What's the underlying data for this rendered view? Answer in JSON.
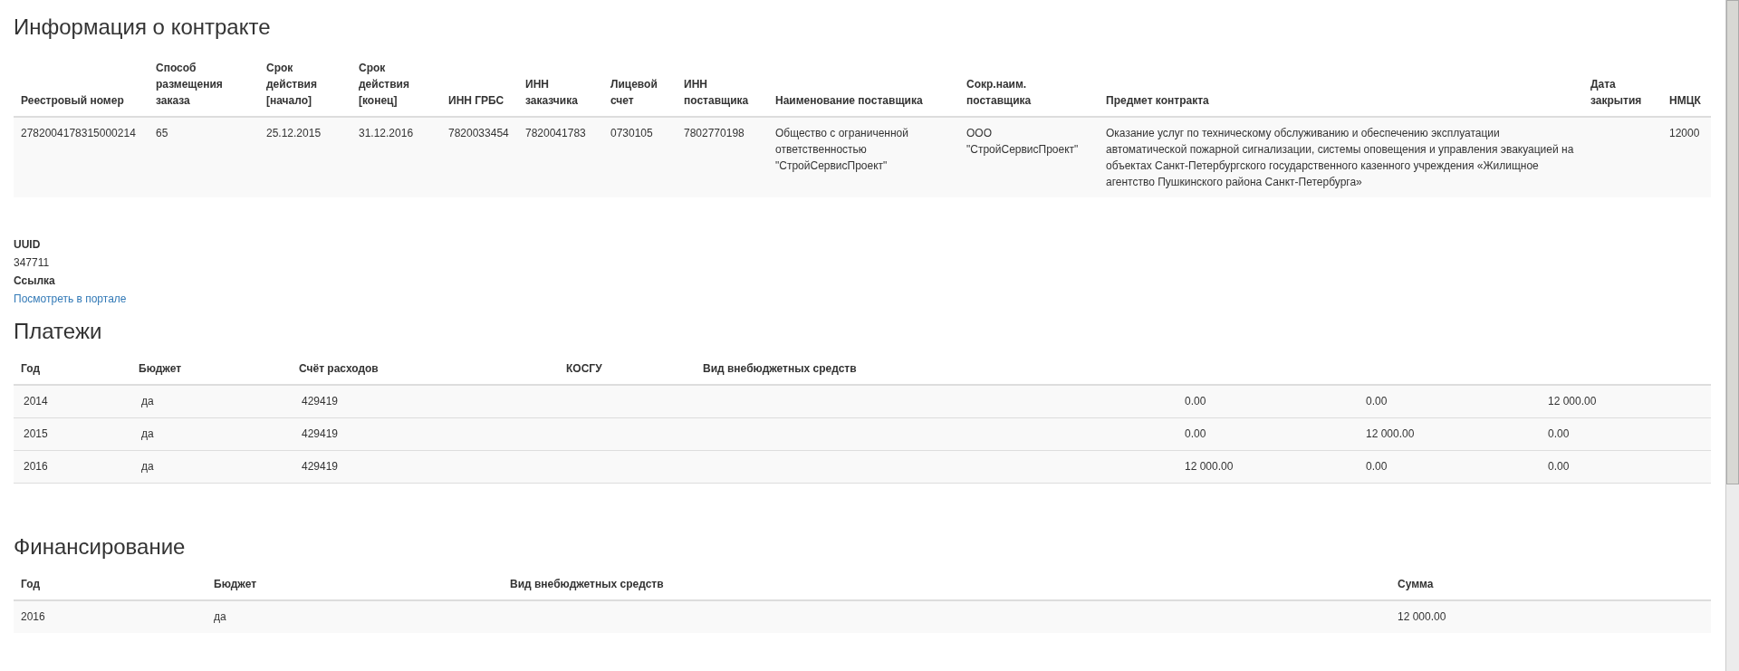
{
  "contract": {
    "title": "Информация о контракте",
    "columns": [
      "Реестровый номер",
      "Способ\nразмещения\nзаказа",
      "Срок\nдействия\n[начало]",
      "Срок\nдействия\n[конец]",
      "ИНН ГРБС",
      "ИНН\nзаказчика",
      "Лицевой\nсчет",
      "ИНН\nпоставщика",
      "Наименование поставщика",
      "Сокр.наим.\nпоставщика",
      "Предмет контракта",
      "Дата\nзакрытия",
      "НМЦК"
    ],
    "rows": [
      {
        "cells": [
          "2782004178315000214",
          "65",
          "25.12.2015",
          "31.12.2016",
          "7820033454",
          "7820041783",
          "0730105",
          "7802770198",
          "Общество с ограниченной ответственностью \"СтройСервисПроект\"",
          "ООО \"СтройСервисПроект\"",
          "Оказание услуг по техническому обслуживанию и обеспечению эксплуатации автоматической пожарной сигнализации, системы оповещения и управления эвакуацией на объектах Санкт-Петербургского государственного казенного учреждения «Жилищное агентство Пушкинского района Санкт-Петербурга»",
          null,
          "12000"
        ]
      }
    ]
  },
  "details": [
    {
      "label": "UUID",
      "value": "347711",
      "kind": "text"
    },
    {
      "label": "Ссылка",
      "value": "Посмотреть в портале",
      "kind": "link"
    }
  ],
  "payments": {
    "title": "Платежи",
    "columns": [
      "Год",
      "Бюджет",
      "Счёт расходов",
      "КОСГУ",
      "Вид внебюджетных средств"
    ],
    "rows": [
      {
        "year": "2014",
        "budget": "да",
        "account": "429419",
        "column_6": "0.00",
        "column_7": "0.00",
        "column_8": "12 000.00"
      },
      {
        "year": "2015",
        "budget": "да",
        "account": "429419",
        "column_6": "0.00",
        "column_7": "12 000.00",
        "column_8": "0.00"
      },
      {
        "year": "2016",
        "budget": "да",
        "account": "429419",
        "column_6": "12 000.00",
        "column_7": "0.00",
        "column_8": "0.00"
      }
    ]
  },
  "financing": {
    "title": "Финансирование",
    "columns": [
      "Год",
      "Бюджет",
      "Вид внебюджетных средств",
      "Сумма"
    ],
    "rows": [
      {
        "year": "2016",
        "budget": "да",
        "amount": "12 000.00"
      }
    ]
  }
}
